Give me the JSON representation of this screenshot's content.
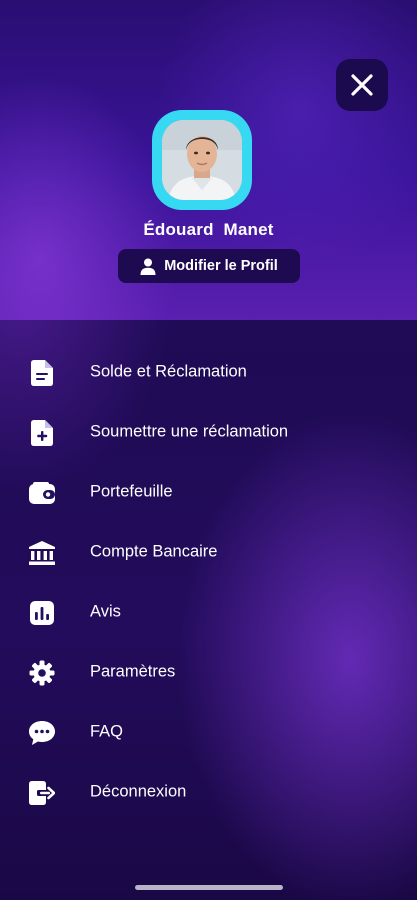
{
  "header": {
    "user_name": "Édouard  Manet",
    "edit_profile_label": "Modifier le Profil"
  },
  "menu": {
    "items": [
      {
        "label": "Solde et Réclamation",
        "icon": "document-icon"
      },
      {
        "label": "Soumettre une réclamation",
        "icon": "document-plus-icon"
      },
      {
        "label": "Portefeuille",
        "icon": "wallet-icon"
      },
      {
        "label": "Compte Bancaire",
        "icon": "bank-icon"
      },
      {
        "label": "Avis",
        "icon": "chart-bars-icon"
      },
      {
        "label": "Paramètres",
        "icon": "gear-icon"
      },
      {
        "label": "FAQ",
        "icon": "chat-bubble-icon"
      },
      {
        "label": "Déconnexion",
        "icon": "logout-icon"
      }
    ]
  },
  "colors": {
    "background": "#1f0b55",
    "header_gradient_end": "#5a1fb0",
    "avatar_ring": "#36d8f2",
    "button_bg": "#1c0a4f",
    "text": "#ffffff"
  }
}
